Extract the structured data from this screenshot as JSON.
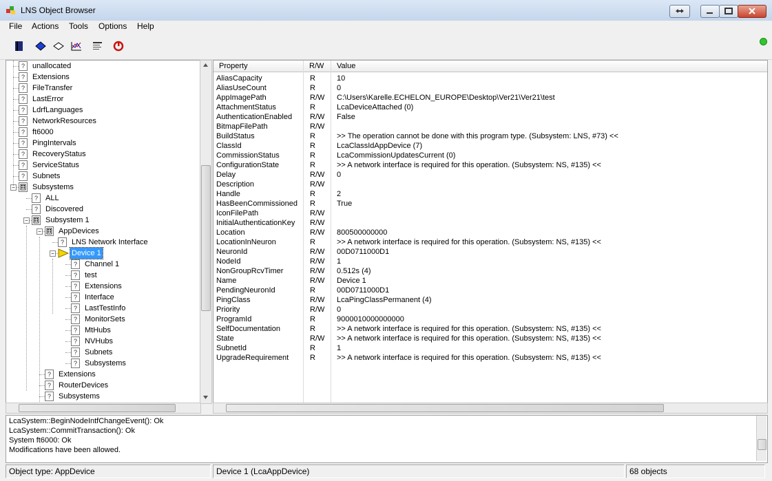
{
  "window": {
    "title": "LNS Object Browser"
  },
  "menu": [
    "File",
    "Actions",
    "Tools",
    "Options",
    "Help"
  ],
  "toolbar": {
    "icons": [
      "book-icon",
      "bookmark-blue-icon",
      "bookmark-outline-icon",
      "chart-icon",
      "list-icon",
      "power-icon"
    ]
  },
  "tree": {
    "items": [
      {
        "label": "unallocated",
        "depth": 4,
        "icon": "question"
      },
      {
        "label": "Extensions",
        "depth": 4,
        "icon": "question"
      },
      {
        "label": "FileTransfer",
        "depth": 4,
        "icon": "question"
      },
      {
        "label": "LastError",
        "depth": 4,
        "icon": "question"
      },
      {
        "label": "LdrfLanguages",
        "depth": 4,
        "icon": "question"
      },
      {
        "label": "NetworkResources",
        "depth": 4,
        "icon": "question"
      },
      {
        "label": "ft6000",
        "depth": 4,
        "icon": "question"
      },
      {
        "label": "PingIntervals",
        "depth": 4,
        "icon": "question"
      },
      {
        "label": "RecoveryStatus",
        "depth": 4,
        "icon": "question"
      },
      {
        "label": "ServiceStatus",
        "depth": 4,
        "icon": "question"
      },
      {
        "label": "Subnets",
        "depth": 4,
        "icon": "question"
      },
      {
        "label": "Subsystems",
        "depth": 4,
        "icon": "folder",
        "expander": "-"
      },
      {
        "label": "ALL",
        "depth": 5,
        "icon": "question"
      },
      {
        "label": "Discovered",
        "depth": 5,
        "icon": "question"
      },
      {
        "label": "Subsystem 1",
        "depth": 5,
        "icon": "folder",
        "expander": "-"
      },
      {
        "label": "AppDevices",
        "depth": 6,
        "icon": "folder",
        "expander": "-"
      },
      {
        "label": "LNS Network Interface",
        "depth": 7,
        "icon": "question"
      },
      {
        "label": "Device 1",
        "depth": 7,
        "icon": "device",
        "expander": "-",
        "selected": true
      },
      {
        "label": "Channel 1",
        "depth": 8,
        "icon": "question"
      },
      {
        "label": "test",
        "depth": 8,
        "icon": "question"
      },
      {
        "label": "Extensions",
        "depth": 8,
        "icon": "question"
      },
      {
        "label": "Interface",
        "depth": 8,
        "icon": "question"
      },
      {
        "label": "LastTestInfo",
        "depth": 8,
        "icon": "question"
      },
      {
        "label": "MonitorSets",
        "depth": 8,
        "icon": "question"
      },
      {
        "label": "MtHubs",
        "depth": 8,
        "icon": "question"
      },
      {
        "label": "NVHubs",
        "depth": 8,
        "icon": "question"
      },
      {
        "label": "Subnets",
        "depth": 8,
        "icon": "question"
      },
      {
        "label": "Subsystems",
        "depth": 8,
        "icon": "question"
      },
      {
        "label": "Extensions",
        "depth": 6,
        "icon": "question"
      },
      {
        "label": "RouterDevices",
        "depth": 6,
        "icon": "question"
      },
      {
        "label": "Subsystems",
        "depth": 6,
        "icon": "question"
      }
    ]
  },
  "grid": {
    "headers": [
      "Property",
      "R/W",
      "Value"
    ],
    "rows": [
      [
        "AliasCapacity",
        "R",
        "10"
      ],
      [
        "AliasUseCount",
        "R",
        "0"
      ],
      [
        "AppImagePath",
        "R/W",
        "C:\\Users\\Karelle.ECHELON_EUROPE\\Desktop\\Ver21\\Ver21\\test"
      ],
      [
        "AttachmentStatus",
        "R",
        "LcaDeviceAttached (0)"
      ],
      [
        "AuthenticationEnabled",
        "R/W",
        "False"
      ],
      [
        "BitmapFilePath",
        "R/W",
        ""
      ],
      [
        "BuildStatus",
        "R",
        ">> The operation cannot be done with this program type. (Subsystem:  LNS, #73) <<"
      ],
      [
        "ClassId",
        "R",
        "LcaClassIdAppDevice (7)"
      ],
      [
        "CommissionStatus",
        "R",
        "LcaCommissionUpdatesCurrent (0)"
      ],
      [
        "ConfigurationState",
        "R",
        ">> A network interface is required for this operation. (Subsystem:  NS, #135) <<"
      ],
      [
        "Delay",
        "R/W",
        "0"
      ],
      [
        "Description",
        "R/W",
        ""
      ],
      [
        "Handle",
        "R",
        "2"
      ],
      [
        "HasBeenCommissioned",
        "R",
        "True"
      ],
      [
        "IconFilePath",
        "R/W",
        ""
      ],
      [
        "InitialAuthenticationKey",
        "R/W",
        ""
      ],
      [
        "Location",
        "R/W",
        "800500000000"
      ],
      [
        "LocationInNeuron",
        "R",
        ">> A network interface is required for this operation. (Subsystem:  NS, #135) <<"
      ],
      [
        "NeuronId",
        "R/W",
        "00D0711000D1"
      ],
      [
        "NodeId",
        "R/W",
        "1"
      ],
      [
        "NonGroupRcvTimer",
        "R/W",
        "0.512s (4)"
      ],
      [
        "Name",
        "R/W",
        "Device 1"
      ],
      [
        "PendingNeuronId",
        "R",
        "00D0711000D1"
      ],
      [
        "PingClass",
        "R/W",
        "LcaPingClassPermanent (4)"
      ],
      [
        "Priority",
        "R/W",
        "0"
      ],
      [
        "ProgramId",
        "R",
        "9000010000000000"
      ],
      [
        "SelfDocumentation",
        "R",
        ">> A network interface is required for this operation. (Subsystem:  NS, #135) <<"
      ],
      [
        "State",
        "R/W",
        ">> A network interface is required for this operation. (Subsystem:  NS, #135) <<"
      ],
      [
        "SubnetId",
        "R",
        "1"
      ],
      [
        "UpgradeRequirement",
        "R",
        ">> A network interface is required for this operation. (Subsystem:  NS, #135) <<"
      ]
    ]
  },
  "log": {
    "lines": [
      "LcaSystem::BeginNodeIntfChangeEvent(): Ok",
      "LcaSystem::CommitTransaction(): Ok",
      "System ft6000: Ok",
      "Modifications have been allowed."
    ]
  },
  "status": {
    "object_type": "Object type: AppDevice",
    "selection": "Device 1 (LcaAppDevice)",
    "count": "68 objects"
  },
  "colors": {
    "selection": "#3399ff",
    "status_indicator": "#2ec72e"
  }
}
